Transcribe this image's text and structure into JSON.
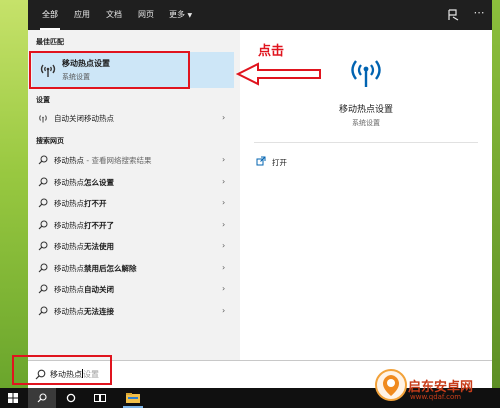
{
  "tabs": [
    {
      "label": "全部",
      "active": true
    },
    {
      "label": "应用",
      "active": false
    },
    {
      "label": "文档",
      "active": false
    },
    {
      "label": "网页",
      "active": false
    },
    {
      "label": "更多",
      "active": false
    }
  ],
  "best_match": {
    "section_label": "最佳匹配",
    "title": "移动热点设置",
    "subtitle": "系统设置",
    "icon": "hotspot-icon"
  },
  "settings": {
    "section_label": "设置",
    "items": [
      {
        "label": "自动关闭移动热点",
        "icon": "hotspot-icon"
      }
    ]
  },
  "web": {
    "section_label": "搜索网页",
    "items": [
      {
        "prefix": "移动热点",
        "suffix": " - 查看网络搜索结果"
      },
      {
        "prefix": "移动热点",
        "suffix": "怎么设置"
      },
      {
        "prefix": "移动热点",
        "suffix": "打不开"
      },
      {
        "prefix": "移动热点",
        "suffix": "打不开了"
      },
      {
        "prefix": "移动热点",
        "suffix": "无法使用"
      },
      {
        "prefix": "移动热点",
        "suffix": "禁用后怎么解除"
      },
      {
        "prefix": "移动热点",
        "suffix": "自动关闭"
      },
      {
        "prefix": "移动热点",
        "suffix": "无法连接"
      }
    ]
  },
  "detail": {
    "title": "移动热点设置",
    "subtitle": "系统设置",
    "actions": [
      {
        "label": "打开",
        "icon": "open-icon"
      }
    ]
  },
  "search": {
    "typed": "移动热点",
    "hint": "设置"
  },
  "annotation": {
    "label": "点击",
    "color": "#e0141e"
  },
  "watermark": {
    "text": "启东安卓网",
    "url": "www.qdaf.com"
  },
  "colors": {
    "accent": "#0063b1",
    "selection": "#cde6f7",
    "annotation_red": "#e0141e"
  }
}
